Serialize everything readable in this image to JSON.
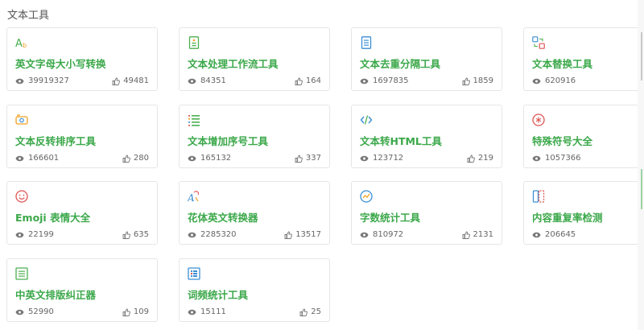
{
  "section": {
    "title": "文本工具"
  },
  "theme": {
    "accent": "#3ba84a",
    "icon_green": "#4caf50",
    "icon_red": "#e05555",
    "icon_blue": "#3b8fd4",
    "icon_orange": "#f0a020"
  },
  "cards": [
    {
      "icon": "font-case-icon",
      "title": "英文字母大小写转换",
      "views": "39919327",
      "likes": "49481"
    },
    {
      "icon": "workflow-icon",
      "title": "文本处理工作流工具",
      "views": "84351",
      "likes": "164"
    },
    {
      "icon": "document-lines-icon",
      "title": "文本去重分隔工具",
      "views": "1697835",
      "likes": "1859"
    },
    {
      "icon": "replace-icon",
      "title": "文本替换工具",
      "views": "620916",
      "likes": ""
    },
    {
      "icon": "reverse-icon",
      "title": "文本反转排序工具",
      "views": "166601",
      "likes": "280"
    },
    {
      "icon": "numbered-list-icon",
      "title": "文本增加序号工具",
      "views": "165132",
      "likes": "337"
    },
    {
      "icon": "code-icon",
      "title": "文本转HTML工具",
      "views": "123712",
      "likes": "219"
    },
    {
      "icon": "asterisk-icon",
      "title": "特殊符号大全",
      "views": "1057366",
      "likes": ""
    },
    {
      "icon": "smile-icon",
      "title": "Emoji 表情大全",
      "views": "22199",
      "likes": "635"
    },
    {
      "icon": "fancy-font-icon",
      "title": "花体英文转换器",
      "views": "2285320",
      "likes": "13517"
    },
    {
      "icon": "chart-icon",
      "title": "字数统计工具",
      "views": "810972",
      "likes": "2131"
    },
    {
      "icon": "compare-icon",
      "title": "内容重复率检测",
      "views": "206645",
      "likes": ""
    },
    {
      "icon": "align-icon",
      "title": "中英文排版纠正器",
      "views": "52990",
      "likes": "109"
    },
    {
      "icon": "word-count-icon",
      "title": "词频统计工具",
      "views": "15111",
      "likes": "25"
    }
  ]
}
